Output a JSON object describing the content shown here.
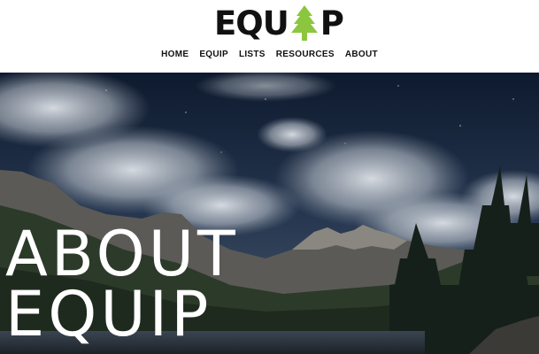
{
  "header": {
    "logo_text_left": "EQU",
    "logo_text_right": "P",
    "logo_icon": "pine-tree-icon",
    "logo_tree_color": "#8cc63f"
  },
  "nav": {
    "items": [
      {
        "label": "HOME"
      },
      {
        "label": "EQUIP"
      },
      {
        "label": "LISTS"
      },
      {
        "label": "RESOURCES"
      },
      {
        "label": "ABOUT"
      }
    ]
  },
  "hero": {
    "title_line1": "ABOUT",
    "title_line2": "EQUIP",
    "title_color": "#ffffff"
  }
}
